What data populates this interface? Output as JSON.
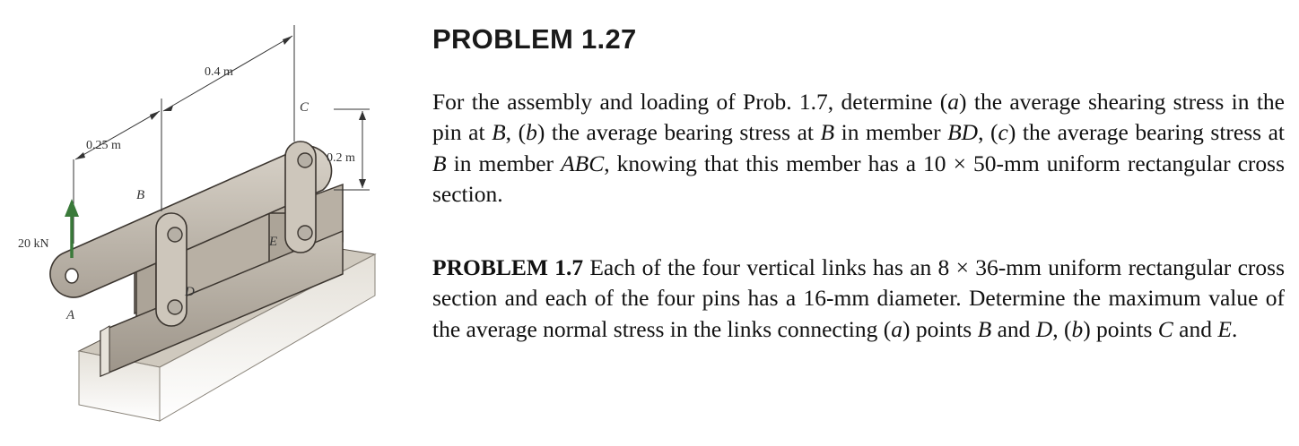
{
  "figure": {
    "labels": {
      "dim_04": "0.4 m",
      "dim_025": "0.25 m",
      "dim_02": "0.2 m",
      "load": "20 kN",
      "A": "A",
      "B": "B",
      "C": "C",
      "D": "D",
      "E": "E"
    },
    "colors": {
      "member_fill": "#c2bbb0",
      "member_stroke": "#3c3630",
      "link_fill": "#cdc6bb",
      "support_fill": "#b9b2a6",
      "pin_fill": "#b6b0a6",
      "arrow": "#3a7a3a"
    }
  },
  "problem": {
    "title": "PROBLEM 1.27",
    "p1": {
      "t1": "For the assembly and loading of Prob. 1.7, determine (",
      "i1": "a",
      "t2": ") the average shearing stress in the pin at ",
      "i2": "B",
      "t3": ", (",
      "i3": "b",
      "t4": ") the average bearing stress at ",
      "i4": "B",
      "t5": " in member ",
      "i5": "BD",
      "t6": ", (",
      "i6": "c",
      "t7": ") the average bearing stress at ",
      "i7": "B",
      "t8": " in member ",
      "i8": "ABC",
      "t9": ", knowing that this member has a 10 × 50-mm uniform rectangular cross section."
    },
    "p2": {
      "bold_label": "PROBLEM 1.7",
      "t1": " Each of the four vertical links has an 8 × 36-mm uniform rectangular cross section and each of the four pins has a 16-mm diameter. Determine the maximum value of the average normal stress in the links connecting (",
      "i1": "a",
      "t2": ") points ",
      "i2": "B",
      "t3": " and ",
      "i3": "D",
      "t4": ", (",
      "i4": "b",
      "t5": ") points ",
      "i5": "C",
      "t6": " and ",
      "i6": "E",
      "t7": "."
    }
  }
}
